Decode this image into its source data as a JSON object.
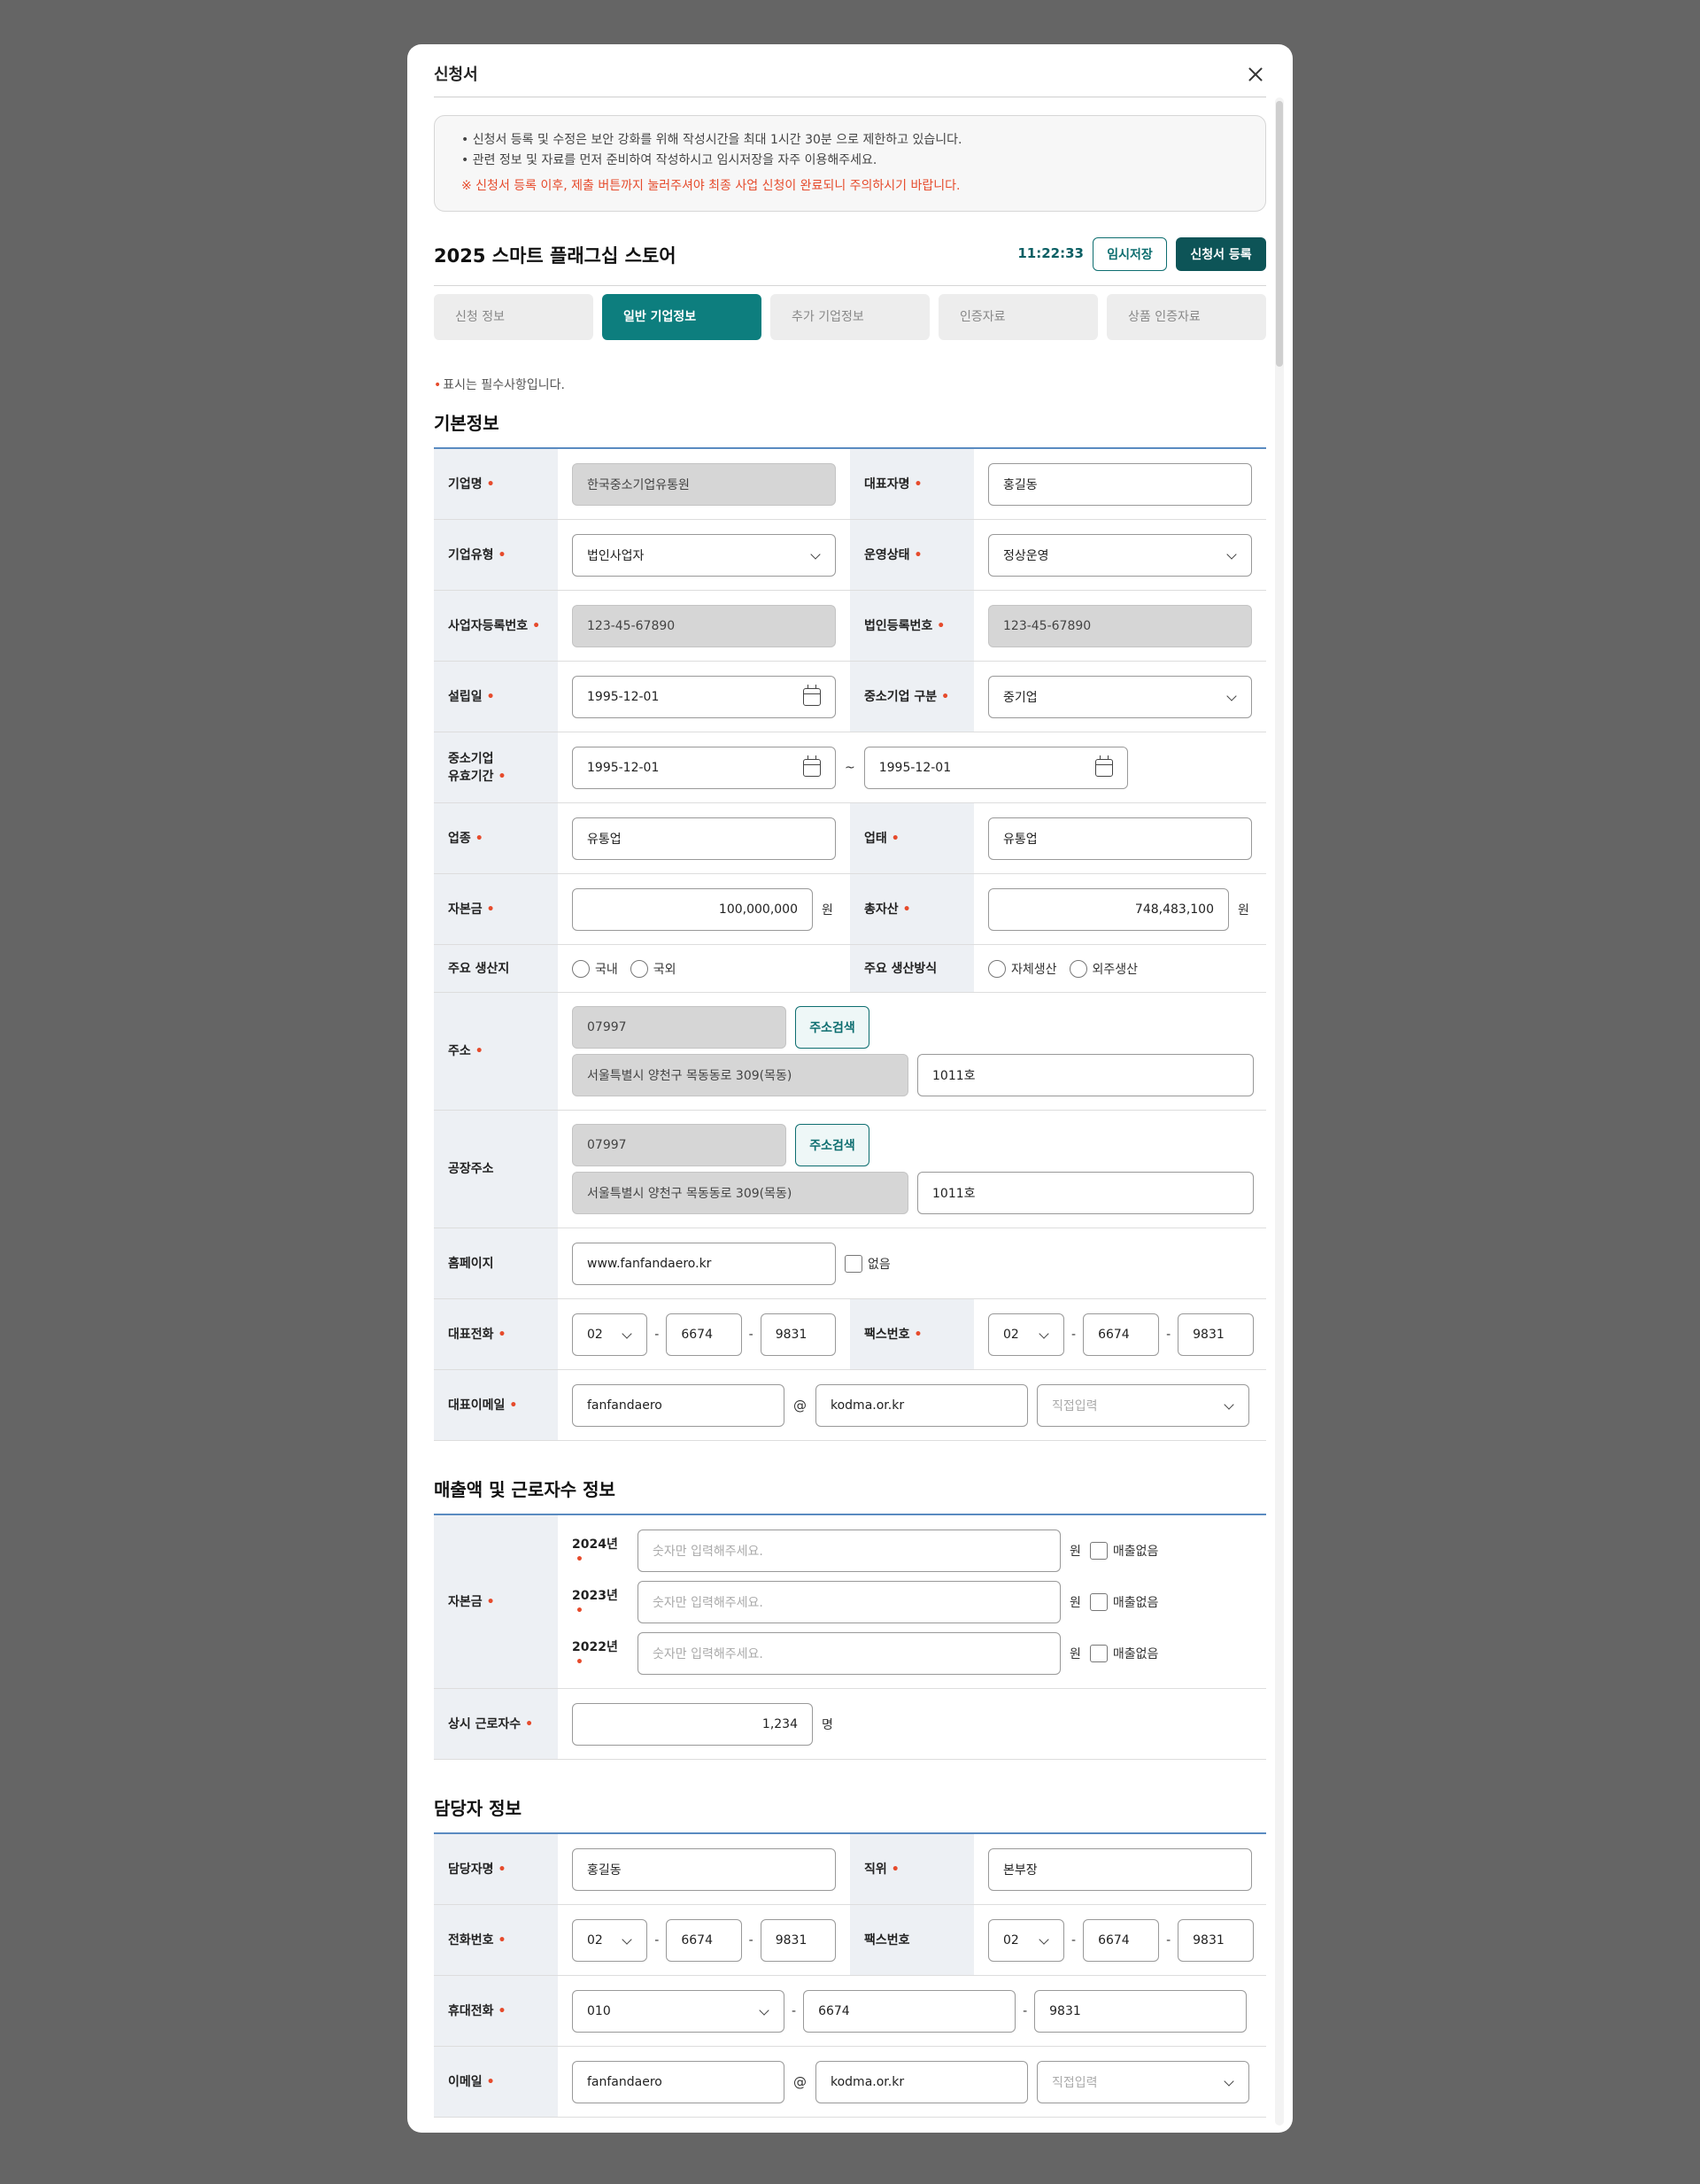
{
  "modal": {
    "title": "신청서"
  },
  "notice": {
    "lines": [
      "• 신청서 등록 및 수정은 보안 강화를 위해 작성시간을 최대 1시간 30분 으로 제한하고 있습니다.",
      "• 관련 정보 및 자료를 먼저 준비하여 작성하시고 임시저장을 자주 이용해주세요."
    ],
    "warning": "※ 신청서 등록 이후, 제출 버튼까지 눌러주셔야 최종 사업 신청이 완료되니 주의하시기 바랍니다."
  },
  "header": {
    "title": "2025 스마트 플래그십 스토어",
    "timer": "11:22:33",
    "save_label": "임시저장",
    "submit_label": "신청서 등록"
  },
  "tabs": [
    {
      "label": "신청 정보",
      "active": false
    },
    {
      "label": "일반 기업정보",
      "active": true
    },
    {
      "label": "추가 기업정보",
      "active": false
    },
    {
      "label": "인증자료",
      "active": false
    },
    {
      "label": "상품 인증자료",
      "active": false
    }
  ],
  "required_note": "표시는 필수사항입니다.",
  "required_mark": "•",
  "basic": {
    "title": "기본정보",
    "company_name": {
      "label": "기업명",
      "value": "한국중소기업유통원"
    },
    "ceo": {
      "label": "대표자명",
      "value": "홍길동"
    },
    "company_type": {
      "label": "기업유형",
      "value": "법인사업자"
    },
    "op_status": {
      "label": "운영상태",
      "value": "정상운영"
    },
    "biz_no": {
      "label": "사업자등록번호",
      "value": "123-45-67890"
    },
    "corp_no": {
      "label": "법인등록번호",
      "value": "123-45-67890"
    },
    "founded": {
      "label": "설립일",
      "value": "1995-12-01"
    },
    "sme_class": {
      "label": "중소기업 구분",
      "value": "중기업"
    },
    "sme_period": {
      "label_line1": "중소기업",
      "label_line2": "유효기간",
      "from": "1995-12-01",
      "to": "1995-12-01",
      "sep": "~"
    },
    "industry": {
      "label": "업종",
      "value": "유통업"
    },
    "business": {
      "label": "업태",
      "value": "유통업"
    },
    "capital": {
      "label": "자본금",
      "value": "100,000,000",
      "unit": "원"
    },
    "assets": {
      "label": "총자산",
      "value": "748,483,100",
      "unit": "원"
    },
    "origin": {
      "label": "주요 생산지",
      "options": [
        "국내",
        "국외"
      ]
    },
    "method": {
      "label": "주요 생산방식",
      "options": [
        "자체생산",
        "외주생산"
      ]
    },
    "address": {
      "label": "주소",
      "zip": "07997",
      "search_label": "주소검색",
      "addr1": "서울특별시 양천구 목동동로 309(목동)",
      "addr2": "1011호"
    },
    "factory": {
      "label": "공장주소",
      "zip": "07997",
      "search_label": "주소검색",
      "addr1": "서울특별시 양천구 목동동로 309(목동)",
      "addr2": "1011호"
    },
    "homepage": {
      "label": "홈페이지",
      "value": "www.fanfandaero.kr",
      "none_label": "없음"
    },
    "phone": {
      "label": "대표전화",
      "p1": "02",
      "p2": "6674",
      "p3": "9831"
    },
    "fax": {
      "label": "팩스번호",
      "p1": "02",
      "p2": "6674",
      "p3": "9831"
    },
    "email": {
      "label": "대표이메일",
      "id": "fanfandaero",
      "at": "@",
      "domain": "kodma.or.kr",
      "select_placeholder": "직접입력"
    }
  },
  "sales": {
    "title": "매출액 및 근로자수 정보",
    "label": "자본금",
    "years": [
      {
        "year": "2024년",
        "placeholder": "숫자만 입력해주세요.",
        "unit": "원",
        "none_label": "매출없음"
      },
      {
        "year": "2023년",
        "placeholder": "숫자만 입력해주세요.",
        "unit": "원",
        "none_label": "매출없음"
      },
      {
        "year": "2022년",
        "placeholder": "숫자만 입력해주세요.",
        "unit": "원",
        "none_label": "매출없음"
      }
    ],
    "workers": {
      "label": "상시 근로자수",
      "value": "1,234",
      "unit": "명"
    }
  },
  "manager": {
    "title": "담당자 정보",
    "name": {
      "label": "담당자명",
      "value": "홍길동"
    },
    "position": {
      "label": "직위",
      "value": "본부장"
    },
    "phone": {
      "label": "전화번호",
      "p1": "02",
      "p2": "6674",
      "p3": "9831"
    },
    "fax": {
      "label": "팩스번호",
      "p1": "02",
      "p2": "6674",
      "p3": "9831"
    },
    "mobile": {
      "label": "휴대전화",
      "p1": "010",
      "p2": "6674",
      "p3": "9831"
    },
    "email": {
      "label": "이메일",
      "id": "fanfandaero",
      "at": "@",
      "domain": "kodma.or.kr",
      "select_placeholder": "직접입력"
    }
  },
  "colors": {
    "accent": "#0d7e7e",
    "accent_dark": "#0d5457",
    "required": "#e64b2c",
    "section_line": "#5a8bc1",
    "label_bg": "#edf0f4"
  },
  "icons": [
    "close-icon",
    "chevron-down-icon",
    "calendar-icon"
  ]
}
